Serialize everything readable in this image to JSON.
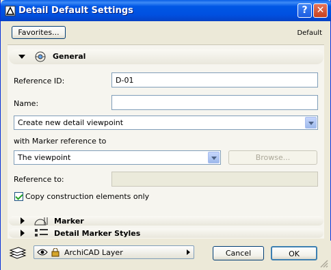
{
  "window": {
    "title": "Detail Default Settings",
    "help_label": "?",
    "close_label": "✕"
  },
  "toolbar": {
    "favorites_label": "Favorites...",
    "default_label": "Default"
  },
  "general": {
    "title": "General",
    "reference_id_label": "Reference ID:",
    "reference_id_value": "D-01",
    "name_label": "Name:",
    "name_value": "",
    "viewpoint_option": "Create new detail viewpoint",
    "marker_ref_label": "with Marker reference to",
    "marker_ref_value": "The viewpoint",
    "browse_label": "Browse...",
    "reference_to_label": "Reference to:",
    "reference_to_value": "",
    "copy_label": "Copy construction elements only",
    "copy_checked": true
  },
  "sections": {
    "marker": "Marker",
    "styles": "Detail Marker Styles"
  },
  "footer": {
    "layer_value": "ArchiCAD Layer",
    "cancel_label": "Cancel",
    "ok_label": "OK"
  },
  "colors": {
    "titlebar": "#0054e3",
    "accent": "#21a121",
    "dialog_bg": "#ece9d8"
  }
}
